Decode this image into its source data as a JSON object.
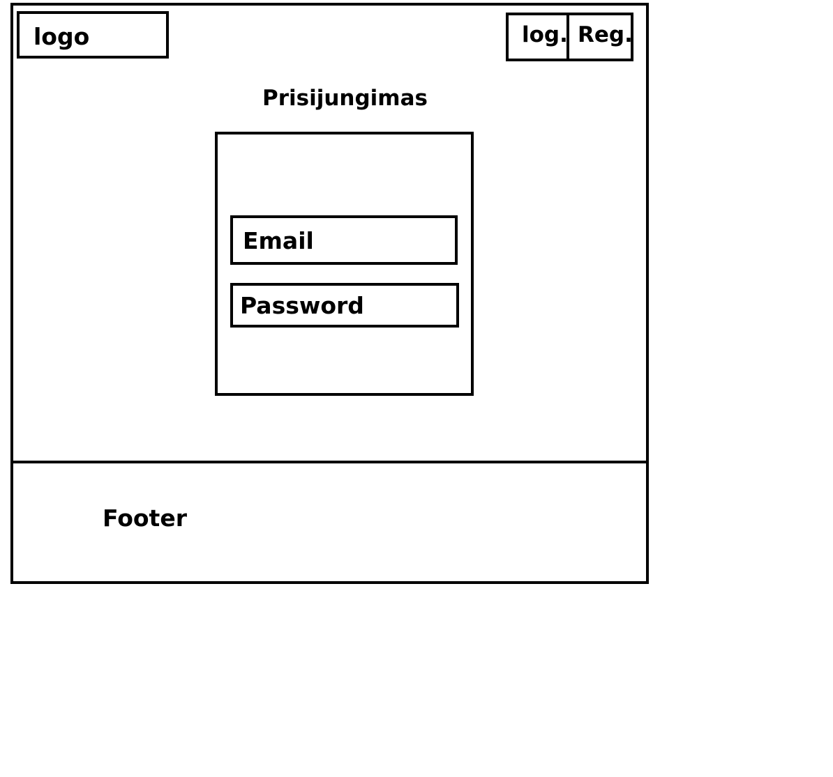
{
  "header": {
    "logo_text": "logo",
    "nav": {
      "login_label": "log.",
      "register_label": "Reg."
    }
  },
  "main": {
    "title": "Prisijungimas",
    "form": {
      "email_placeholder": "Email",
      "password_placeholder": "Password"
    }
  },
  "footer": {
    "text": "Footer"
  }
}
